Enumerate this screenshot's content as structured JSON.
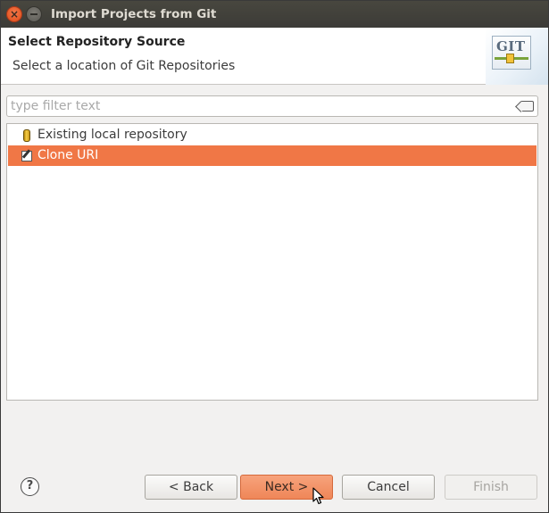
{
  "window": {
    "title": "Import Projects from Git"
  },
  "header": {
    "title": "Select Repository Source",
    "description": "Select a location of Git Repositories",
    "logo_text": "GIT"
  },
  "filter": {
    "placeholder": "type filter text",
    "value": ""
  },
  "tree": {
    "items": [
      {
        "label": "Existing local repository",
        "icon": "repository-icon",
        "selected": false
      },
      {
        "label": "Clone URI",
        "icon": "clone-uri-icon",
        "selected": true
      }
    ]
  },
  "buttons": {
    "help": "?",
    "back": "< Back",
    "next": "Next >",
    "cancel": "Cancel",
    "finish": "Finish"
  },
  "colors": {
    "selection": "#f07746",
    "titlebar": "#3c3b37",
    "close_button": "#df4a16"
  }
}
